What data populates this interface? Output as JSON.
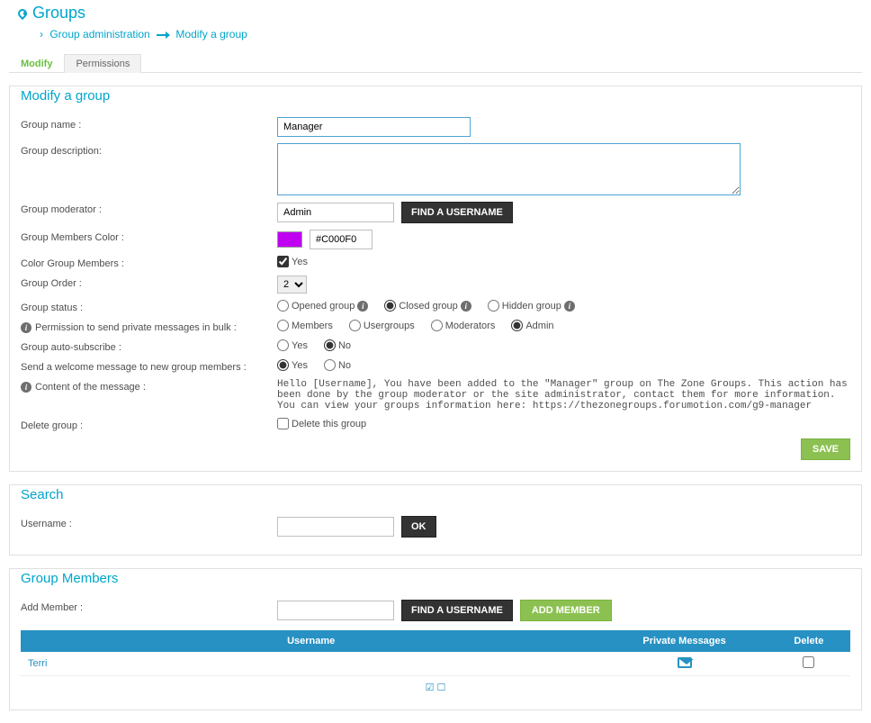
{
  "header": {
    "title": "Groups",
    "breadcrumb": {
      "item1": "Group administration",
      "item2": "Modify a group"
    }
  },
  "tabs": {
    "modify": "Modify",
    "permissions": "Permissions"
  },
  "modify": {
    "legend": "Modify a group",
    "labels": {
      "name": "Group name :",
      "desc": "Group description:",
      "moderator": "Group moderator :",
      "color": "Group Members Color :",
      "color_members": "Color Group Members :",
      "order": "Group Order :",
      "status": "Group status :",
      "perm_bulk": "Permission to send private messages in bulk :",
      "auto_subscribe": "Group auto-subscribe :",
      "welcome": "Send a welcome message to new group members :",
      "msg_content": "Content of the message :",
      "delete": "Delete group :"
    },
    "name_value": "Manager",
    "moderator_value": "Admin",
    "find_username": "FIND A USERNAME",
    "color_hex": "#C000F0",
    "color_members_yes": "Yes",
    "order_value": "2",
    "status_options": {
      "opened": "Opened group",
      "closed": "Closed group",
      "hidden": "Hidden group"
    },
    "bulk_options": {
      "members": "Members",
      "usergroups": "Usergroups",
      "moderators": "Moderators",
      "admin": "Admin"
    },
    "yesno": {
      "yes": "Yes",
      "no": "No"
    },
    "message": "Hello [Username], You have been added to the \"Manager\" group on The Zone Groups. This action has been done by the group moderator or the site administrator, contact them for more information. You can view your groups information here: https://thezonegroups.forumotion.com/g9-manager",
    "delete_option": "Delete this group",
    "save": "SAVE"
  },
  "search": {
    "legend": "Search",
    "label": "Username :",
    "ok": "OK"
  },
  "members": {
    "legend": "Group Members",
    "add_label": "Add Member :",
    "find_username": "FIND A USERNAME",
    "add_member": "ADD MEMBER",
    "headers": {
      "username": "Username",
      "pm": "Private Messages",
      "delete": "Delete"
    },
    "rows": [
      {
        "username": "Terri"
      }
    ]
  }
}
